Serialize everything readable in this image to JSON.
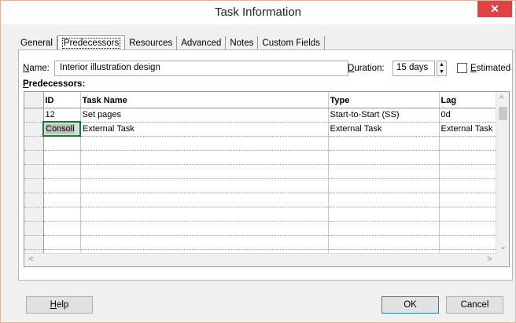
{
  "window": {
    "title": "Task Information",
    "close_glyph": "✕"
  },
  "tabs": [
    {
      "label": "General"
    },
    {
      "label": "Predecessors"
    },
    {
      "label": "Resources"
    },
    {
      "label": "Advanced"
    },
    {
      "label": "Notes"
    },
    {
      "label": "Custom Fields"
    }
  ],
  "form": {
    "name_label_u": "N",
    "name_label_rest": "ame:",
    "name_value": "Interior illustration design",
    "duration_label_u": "D",
    "duration_label_rest": "uration:",
    "duration_value": "15 days",
    "estimated_label_u": "E",
    "estimated_label_rest": "stimated",
    "estimated_checked": false,
    "predecessors_label_u": "P",
    "predecessors_label_rest": "redecessors:"
  },
  "grid": {
    "columns": [
      "ID",
      "Task Name",
      "Type",
      "Lag"
    ],
    "rows": [
      {
        "id": "12",
        "task_name": "Set pages",
        "type": "Start-to-Start (SS)",
        "lag": "0d"
      },
      {
        "id": "Consoli",
        "task_name": "External Task",
        "type": "External Task",
        "lag": "External Task"
      }
    ]
  },
  "buttons": {
    "help_u": "H",
    "help_rest": "elp",
    "ok": "OK",
    "cancel": "Cancel"
  },
  "colors": {
    "close": "#e04343",
    "selected_border": "#217346",
    "default_button_border": "#2a7bd3"
  }
}
